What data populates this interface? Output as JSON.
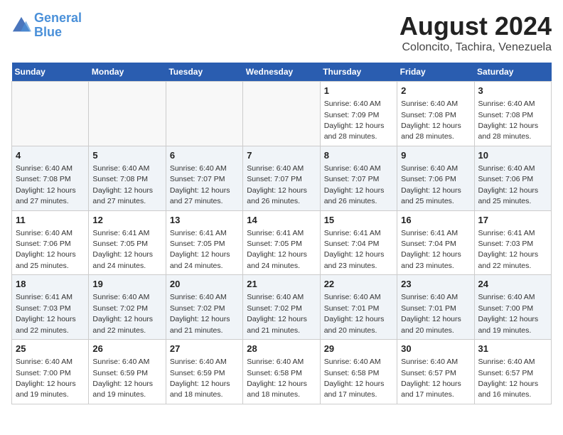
{
  "logo": {
    "line1": "General",
    "line2": "Blue"
  },
  "title": "August 2024",
  "subtitle": "Coloncito, Tachira, Venezuela",
  "days_of_week": [
    "Sunday",
    "Monday",
    "Tuesday",
    "Wednesday",
    "Thursday",
    "Friday",
    "Saturday"
  ],
  "weeks": [
    {
      "id": "week1",
      "bg": "odd",
      "days": [
        {
          "num": "",
          "info": ""
        },
        {
          "num": "",
          "info": ""
        },
        {
          "num": "",
          "info": ""
        },
        {
          "num": "",
          "info": ""
        },
        {
          "num": "1",
          "info": "Sunrise: 6:40 AM\nSunset: 7:09 PM\nDaylight: 12 hours\nand 28 minutes."
        },
        {
          "num": "2",
          "info": "Sunrise: 6:40 AM\nSunset: 7:08 PM\nDaylight: 12 hours\nand 28 minutes."
        },
        {
          "num": "3",
          "info": "Sunrise: 6:40 AM\nSunset: 7:08 PM\nDaylight: 12 hours\nand 28 minutes."
        }
      ]
    },
    {
      "id": "week2",
      "bg": "even",
      "days": [
        {
          "num": "4",
          "info": "Sunrise: 6:40 AM\nSunset: 7:08 PM\nDaylight: 12 hours\nand 27 minutes."
        },
        {
          "num": "5",
          "info": "Sunrise: 6:40 AM\nSunset: 7:08 PM\nDaylight: 12 hours\nand 27 minutes."
        },
        {
          "num": "6",
          "info": "Sunrise: 6:40 AM\nSunset: 7:07 PM\nDaylight: 12 hours\nand 27 minutes."
        },
        {
          "num": "7",
          "info": "Sunrise: 6:40 AM\nSunset: 7:07 PM\nDaylight: 12 hours\nand 26 minutes."
        },
        {
          "num": "8",
          "info": "Sunrise: 6:40 AM\nSunset: 7:07 PM\nDaylight: 12 hours\nand 26 minutes."
        },
        {
          "num": "9",
          "info": "Sunrise: 6:40 AM\nSunset: 7:06 PM\nDaylight: 12 hours\nand 25 minutes."
        },
        {
          "num": "10",
          "info": "Sunrise: 6:40 AM\nSunset: 7:06 PM\nDaylight: 12 hours\nand 25 minutes."
        }
      ]
    },
    {
      "id": "week3",
      "bg": "odd",
      "days": [
        {
          "num": "11",
          "info": "Sunrise: 6:40 AM\nSunset: 7:06 PM\nDaylight: 12 hours\nand 25 minutes."
        },
        {
          "num": "12",
          "info": "Sunrise: 6:41 AM\nSunset: 7:05 PM\nDaylight: 12 hours\nand 24 minutes."
        },
        {
          "num": "13",
          "info": "Sunrise: 6:41 AM\nSunset: 7:05 PM\nDaylight: 12 hours\nand 24 minutes."
        },
        {
          "num": "14",
          "info": "Sunrise: 6:41 AM\nSunset: 7:05 PM\nDaylight: 12 hours\nand 24 minutes."
        },
        {
          "num": "15",
          "info": "Sunrise: 6:41 AM\nSunset: 7:04 PM\nDaylight: 12 hours\nand 23 minutes."
        },
        {
          "num": "16",
          "info": "Sunrise: 6:41 AM\nSunset: 7:04 PM\nDaylight: 12 hours\nand 23 minutes."
        },
        {
          "num": "17",
          "info": "Sunrise: 6:41 AM\nSunset: 7:03 PM\nDaylight: 12 hours\nand 22 minutes."
        }
      ]
    },
    {
      "id": "week4",
      "bg": "even",
      "days": [
        {
          "num": "18",
          "info": "Sunrise: 6:41 AM\nSunset: 7:03 PM\nDaylight: 12 hours\nand 22 minutes."
        },
        {
          "num": "19",
          "info": "Sunrise: 6:40 AM\nSunset: 7:02 PM\nDaylight: 12 hours\nand 22 minutes."
        },
        {
          "num": "20",
          "info": "Sunrise: 6:40 AM\nSunset: 7:02 PM\nDaylight: 12 hours\nand 21 minutes."
        },
        {
          "num": "21",
          "info": "Sunrise: 6:40 AM\nSunset: 7:02 PM\nDaylight: 12 hours\nand 21 minutes."
        },
        {
          "num": "22",
          "info": "Sunrise: 6:40 AM\nSunset: 7:01 PM\nDaylight: 12 hours\nand 20 minutes."
        },
        {
          "num": "23",
          "info": "Sunrise: 6:40 AM\nSunset: 7:01 PM\nDaylight: 12 hours\nand 20 minutes."
        },
        {
          "num": "24",
          "info": "Sunrise: 6:40 AM\nSunset: 7:00 PM\nDaylight: 12 hours\nand 19 minutes."
        }
      ]
    },
    {
      "id": "week5",
      "bg": "odd",
      "days": [
        {
          "num": "25",
          "info": "Sunrise: 6:40 AM\nSunset: 7:00 PM\nDaylight: 12 hours\nand 19 minutes."
        },
        {
          "num": "26",
          "info": "Sunrise: 6:40 AM\nSunset: 6:59 PM\nDaylight: 12 hours\nand 19 minutes."
        },
        {
          "num": "27",
          "info": "Sunrise: 6:40 AM\nSunset: 6:59 PM\nDaylight: 12 hours\nand 18 minutes."
        },
        {
          "num": "28",
          "info": "Sunrise: 6:40 AM\nSunset: 6:58 PM\nDaylight: 12 hours\nand 18 minutes."
        },
        {
          "num": "29",
          "info": "Sunrise: 6:40 AM\nSunset: 6:58 PM\nDaylight: 12 hours\nand 17 minutes."
        },
        {
          "num": "30",
          "info": "Sunrise: 6:40 AM\nSunset: 6:57 PM\nDaylight: 12 hours\nand 17 minutes."
        },
        {
          "num": "31",
          "info": "Sunrise: 6:40 AM\nSunset: 6:57 PM\nDaylight: 12 hours\nand 16 minutes."
        }
      ]
    }
  ]
}
